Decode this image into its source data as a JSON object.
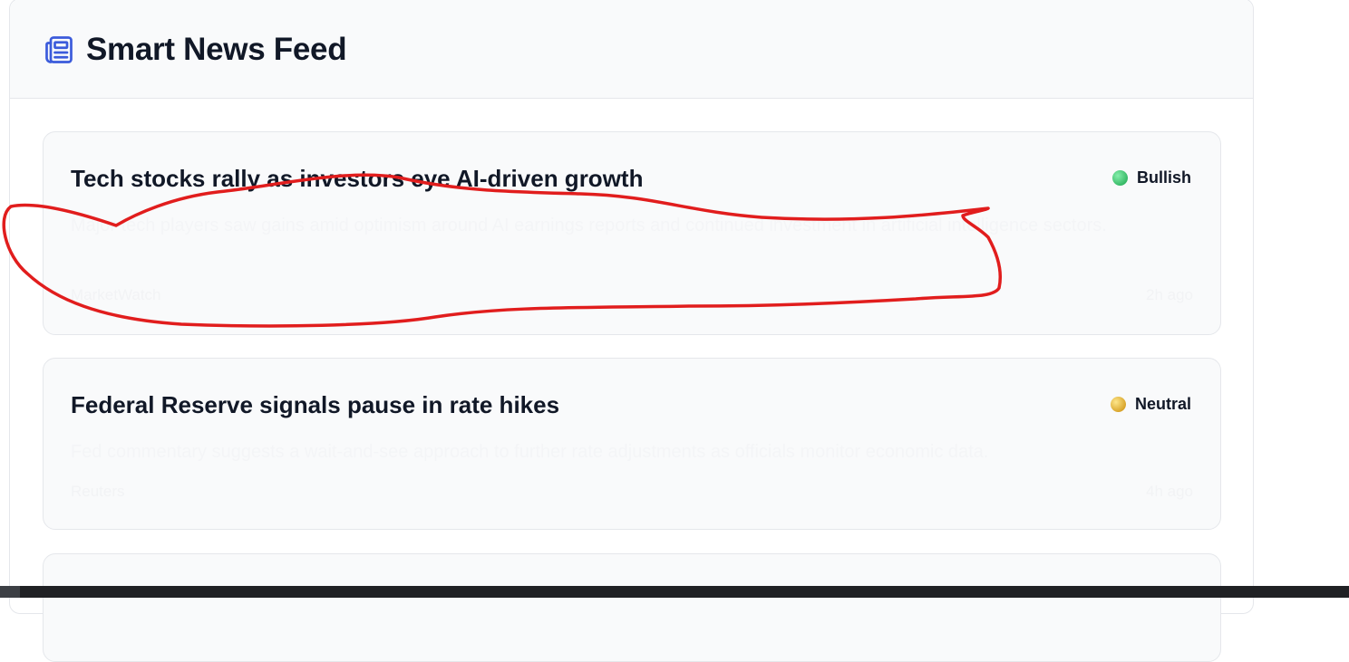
{
  "header": {
    "icon": "newspaper-icon",
    "title": "Smart News Feed"
  },
  "articles": [
    {
      "title": "Tech stocks rally as investors eye AI-driven growth",
      "sentiment": "Bullish",
      "sentiment_color": "#22c55e",
      "summary": "Major tech players saw gains amid optimism around AI earnings reports and continued investment in artificial intelligence sectors.",
      "source": "MarketWatch",
      "time": "2h ago"
    },
    {
      "title": "Federal Reserve signals pause in rate hikes",
      "sentiment": "Neutral",
      "sentiment_color": "#eab308",
      "summary": "Fed commentary suggests a wait-and-see approach to further rate adjustments as officials monitor economic data.",
      "source": "Reuters",
      "time": "4h ago"
    }
  ],
  "colors": {
    "accent": "#3b5bdb",
    "annotation": "#e11d1d"
  }
}
